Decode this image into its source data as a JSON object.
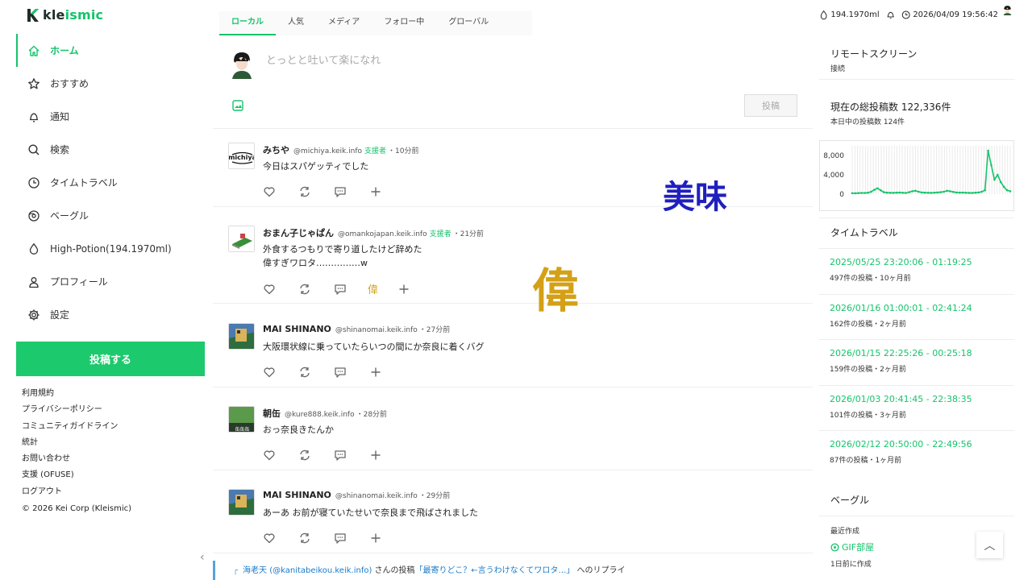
{
  "logo": {
    "prefix": "kle",
    "accent": "ismic"
  },
  "nav": [
    {
      "label": "ホーム",
      "icon": "home-icon",
      "active": true
    },
    {
      "label": "おすすめ",
      "icon": "star-icon"
    },
    {
      "label": "通知",
      "icon": "bell-icon"
    },
    {
      "label": "検索",
      "icon": "search-icon"
    },
    {
      "label": "タイムトラベル",
      "icon": "clock-icon"
    },
    {
      "label": "ベーグル",
      "icon": "bagel-icon"
    },
    {
      "label": "High-Potion(194.1970ml)",
      "icon": "drop-icon"
    },
    {
      "label": "プロフィール",
      "icon": "user-icon"
    },
    {
      "label": "設定",
      "icon": "gear-icon"
    }
  ],
  "post_button": "投稿する",
  "footer_links": [
    "利用規約",
    "プライバシーポリシー",
    "コミュニティガイドライン",
    "統計",
    "お問い合わせ",
    "支援 (OFUSE)",
    "ログアウト"
  ],
  "copyright": "© 2026 Kei Corp (Kleismic)",
  "tabs": [
    "ローカル",
    "人気",
    "メディア",
    "フォロー中",
    "グローバル"
  ],
  "composer": {
    "placeholder": "とっとと吐いて楽になれ",
    "submit": "投稿"
  },
  "posts": [
    {
      "name": "みちや",
      "handle": "@michiya.keik.info",
      "badge": "支援者",
      "time": "・10分前",
      "lines": [
        "今日はスパゲッティでした"
      ]
    },
    {
      "name": "おまん子じゃぱん",
      "handle": "@omankojapan.keik.info",
      "badge": "支援者",
      "time": "・21分前",
      "lines": [
        "外食するつもりで寄り道したけど辞めた",
        "偉すぎワロタ……………w"
      ],
      "reaction": "偉"
    },
    {
      "name": "MAI SHINANO",
      "handle": "@shinanomai.keik.info",
      "badge": "",
      "time": "・27分前",
      "lines": [
        "大阪環状線に乗っていたらいつの間にか奈良に着くバグ"
      ]
    },
    {
      "name": "朝缶",
      "handle": "@kure888.keik.info",
      "badge": "",
      "time": "・28分前",
      "lines": [
        "おっ奈良きたんか"
      ]
    },
    {
      "name": "MAI SHINANO",
      "handle": "@shinanomai.keik.info",
      "badge": "",
      "time": "・29分前",
      "lines": [
        "あーあ お前が寝ていたせいで奈良まで飛ばされました"
      ]
    }
  ],
  "reply_preview": {
    "user": "海老天 (@kanitabeikou.keik.info)",
    "mid": " さんの投稿",
    "quote": "「最寄りどこ？←言うわけなくてワロタ…」",
    "tail": " へのリプライ"
  },
  "overlays": {
    "big1": "美味",
    "big2": "偉"
  },
  "topbar": {
    "potion": "194.1970ml",
    "datetime": "2026/04/09 19:56:42"
  },
  "remote": {
    "title": "リモートスクリーン",
    "status": "接続"
  },
  "stats": {
    "title": "現在の総投稿数 122,336件",
    "today": "本日中の投稿数 124件"
  },
  "chart_data": {
    "type": "line",
    "yticks": [
      "8,000",
      "4,000",
      "0"
    ],
    "ylim": [
      0,
      10000
    ],
    "grid": true,
    "values": [
      200,
      180,
      220,
      250,
      240,
      300,
      500,
      900,
      1200,
      800,
      400,
      300,
      280,
      260,
      300,
      320,
      280,
      250,
      400,
      600,
      700,
      500,
      350,
      300,
      280,
      260,
      300,
      350,
      400,
      500,
      700,
      600,
      450,
      350,
      300,
      320,
      280,
      260,
      240,
      300,
      350,
      500,
      800,
      9000,
      6000,
      3000,
      4000,
      2500,
      1500,
      800,
      600
    ]
  },
  "timetravel": {
    "title": "タイムトラベル",
    "items": [
      {
        "range": "2025/05/25 23:20:06 - 01:19:25",
        "meta": "497件の投稿・10ヶ月前"
      },
      {
        "range": "2026/01/16 01:00:01 - 02:41:24",
        "meta": "162件の投稿・2ヶ月前"
      },
      {
        "range": "2026/01/15 22:25:26 - 00:25:18",
        "meta": "159件の投稿・2ヶ月前"
      },
      {
        "range": "2026/01/03 20:41:45 - 22:38:35",
        "meta": "101件の投稿・3ヶ月前"
      },
      {
        "range": "2026/02/12 20:50:00 - 22:49:56",
        "meta": "87件の投稿・1ヶ月前"
      }
    ]
  },
  "bagel": {
    "title": "ベーグル",
    "recent": "最近作成",
    "room": "GIF部屋",
    "room_meta": "1日前に作成"
  },
  "colors": {
    "accent": "#16c36b",
    "reaction": "#d4a017",
    "overlay_blue": "#1f1fbf"
  }
}
